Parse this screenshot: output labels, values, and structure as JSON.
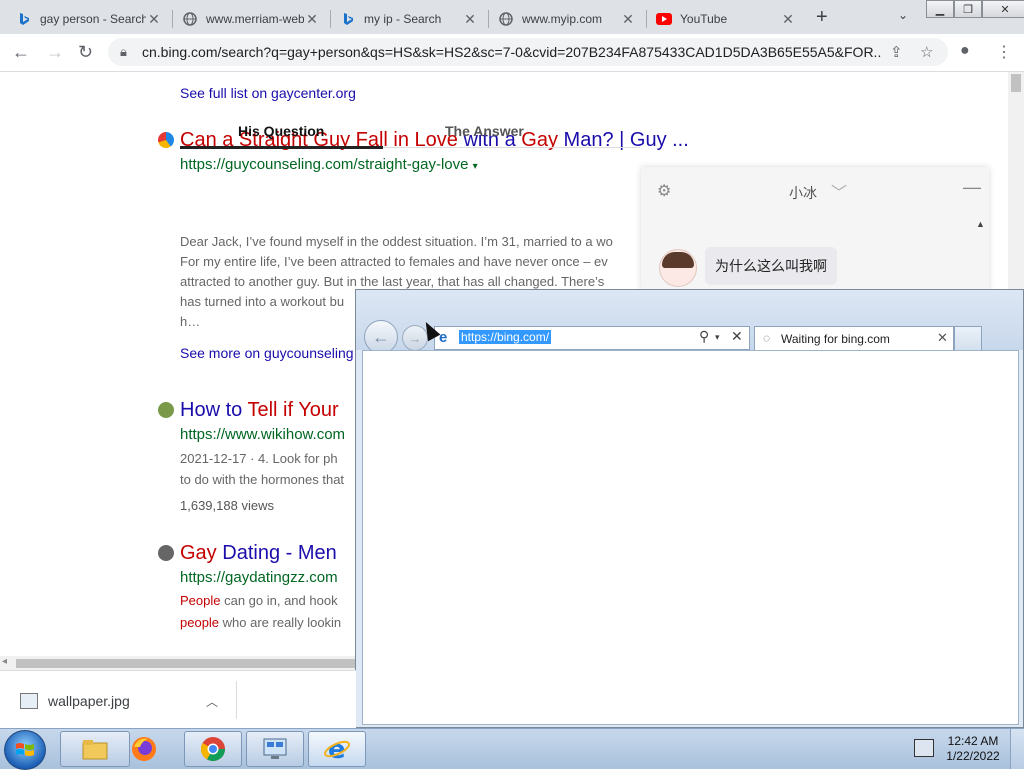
{
  "chrome": {
    "tabs": [
      {
        "title": "gay person - Search",
        "icon": "bing-icon"
      },
      {
        "title": "www.merriam-webster",
        "icon": "globe-icon"
      },
      {
        "title": "my ip - Search",
        "icon": "bing-icon"
      },
      {
        "title": "www.myip.com",
        "icon": "globe-icon"
      },
      {
        "title": "YouTube",
        "icon": "youtube-icon"
      }
    ],
    "new_tab": "+",
    "url": "cn.bing.com/search?q=gay+person&qs=HS&sk=HS2&sc=7-0&cvid=207B234FA875433CAD1D5DA3B65E55A5&FOR..."
  },
  "results": {
    "see_full_list": "See full list on gaycenter.org",
    "r1": {
      "title_parts": [
        {
          "text": "Can a Straight Guy Fall in Love ",
          "color": "red"
        },
        {
          "text": "with a ",
          "color": "blue"
        },
        {
          "text": "Gay ",
          "color": "red"
        },
        {
          "text": "Man? | Guy ...",
          "color": "blue"
        }
      ],
      "url": "https://guycounseling.com/straight-gay-love",
      "tab_question": "His Question",
      "tab_answer": "The Answer",
      "snippet": [
        "Dear Jack, I’ve found myself in the oddest situation. I’m 31, married to a wo",
        "For my entire life, I’ve been attracted to females and have never once – ev",
        "attracted to another guy. But in the last year, that has all changed. There’s",
        "has turned into a workout bu",
        "h…"
      ],
      "see_more": "See more on guycounseling"
    },
    "r2": {
      "title_parts": [
        {
          "text": "How to ",
          "color": "blue"
        },
        {
          "text": "Tell if Your",
          "color": "red"
        }
      ],
      "url": "https://www.wikihow.com",
      "snippet": [
        "2021-12-17  ·  4. Look for ph",
        "to do with the hormones that"
      ],
      "views": "1,639,188 views"
    },
    "r3": {
      "title_parts": [
        {
          "text": "Gay ",
          "color": "red"
        },
        {
          "text": "Dating ",
          "color": "blue"
        },
        {
          "text": "- Men",
          "color": "blue"
        }
      ],
      "url": "https://gaydatingzz.com",
      "line1_red": "People",
      "line1_rest": " can go in, and hook",
      "line2_red": "people",
      "line2_rest": " who are really lookin"
    }
  },
  "chat": {
    "name": "小冰",
    "message": "为什么这么叫我啊"
  },
  "ie": {
    "address": "https://bing.com/",
    "tab_title": "Waiting for bing.com"
  },
  "download": {
    "file": "wallpaper.jpg"
  },
  "taskbar": {
    "time": "12:42 AM",
    "date": "1/22/2022"
  }
}
